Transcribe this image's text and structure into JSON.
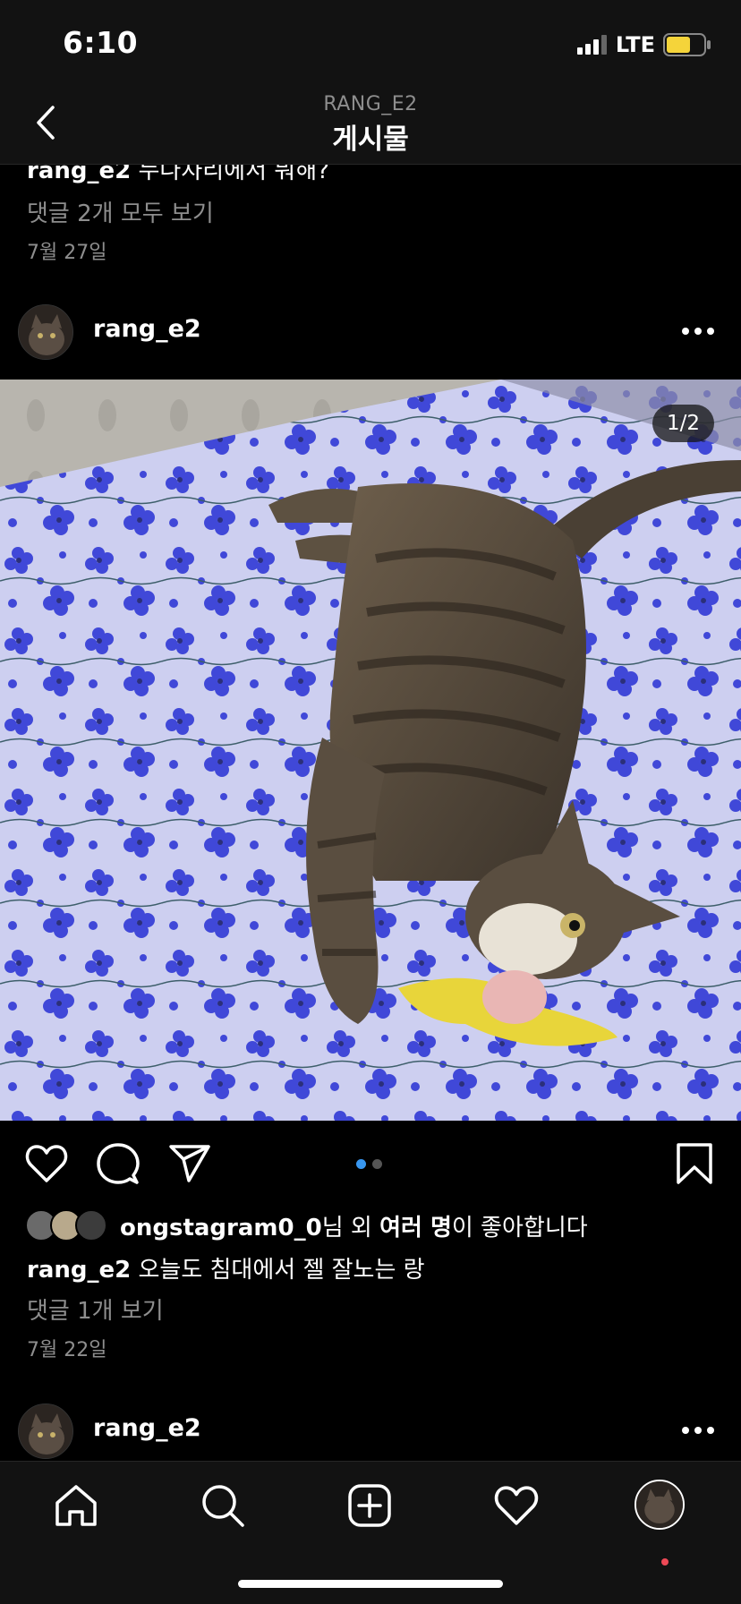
{
  "status_bar": {
    "time": "6:10",
    "network": "LTE"
  },
  "nav": {
    "subtitle": "RANG_E2",
    "title": "게시물"
  },
  "previous_post": {
    "caption_user": "rang_e2",
    "caption_text": "누나자리에서 뭐해?",
    "comments_link": "댓글 2개 모두 보기",
    "date": "7월 27일"
  },
  "post": {
    "username": "rang_e2",
    "image_counter": "1/2",
    "image_icon": "tabby-cat-on-bed-photo",
    "liked_by_user": "ongstagram0_0",
    "likes_text_1": "님 외 ",
    "likes_bold": "여러 명",
    "likes_text_2": "이 좋아합니다",
    "caption_user": "rang_e2",
    "caption_text": "오늘도 침대에서 젤 잘노는 랑",
    "comments_link": "댓글 1개 보기",
    "date": "7월 22일",
    "carousel": {
      "count": 2,
      "active": 1
    }
  },
  "next_post": {
    "username": "rang_e2"
  },
  "tab_bar": {
    "icons": [
      "home-icon",
      "search-icon",
      "new-post-icon",
      "activity-heart-icon",
      "profile-avatar"
    ]
  },
  "colors": {
    "background": "#000000",
    "bar": "#121212",
    "muted": "#8e8e8e",
    "accent": "#3897f0",
    "battery": "#f5d43a",
    "notification": "#ed4956"
  }
}
